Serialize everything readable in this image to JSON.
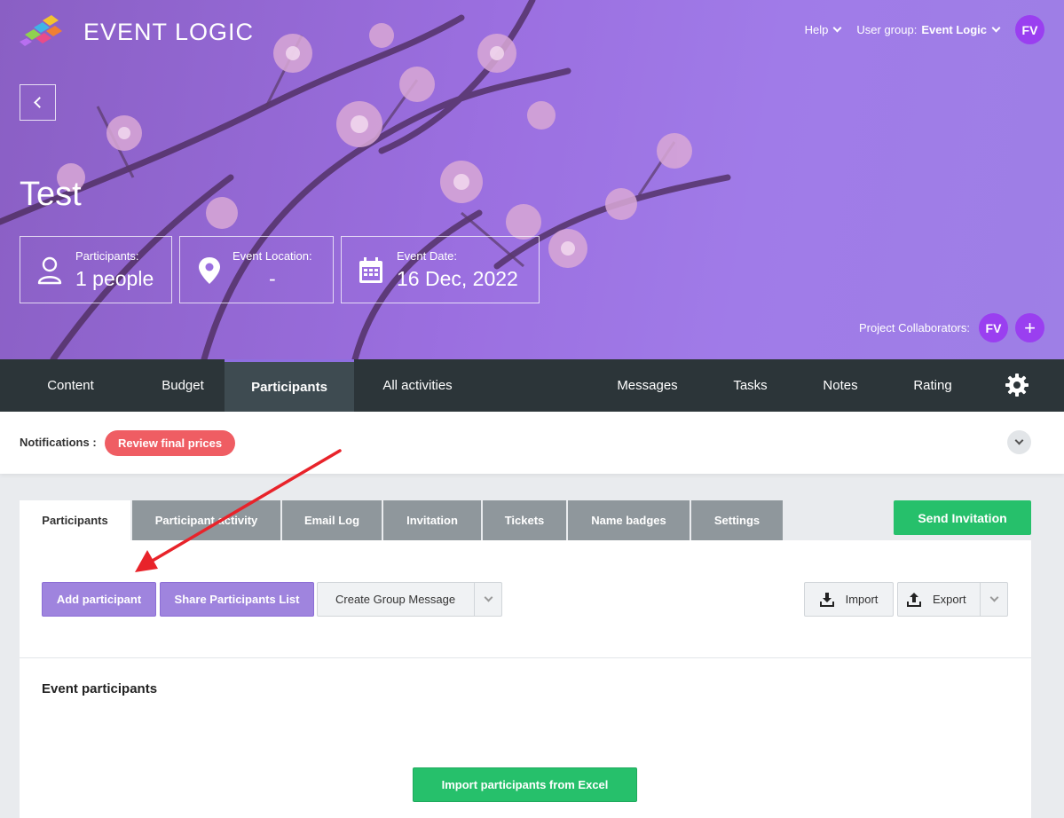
{
  "brand": {
    "name": "EVENT LOGIC"
  },
  "header": {
    "help_label": "Help",
    "user_group_label": "User group:",
    "user_group_value": "Event Logic",
    "user_initials": "FV"
  },
  "event": {
    "title": "Test",
    "info": [
      {
        "label": "Participants:",
        "value": "1 people",
        "icon": "person-icon"
      },
      {
        "label": "Event Location:",
        "value": "-",
        "icon": "location-pin-icon"
      },
      {
        "label": "Event Date:",
        "value": "16 Dec, 2022",
        "icon": "calendar-icon"
      }
    ],
    "collaborators_label": "Project Collaborators:",
    "collaborator_initials": "FV",
    "add_collaborator": "+"
  },
  "nav": {
    "items": [
      "Content",
      "Budget",
      "Participants",
      "All activities",
      "Messages",
      "Tasks",
      "Notes",
      "Rating"
    ],
    "active": "Participants"
  },
  "notifications": {
    "label": "Notifications :",
    "badge": "Review final prices"
  },
  "tabs": {
    "items": [
      "Participants",
      "Participant activity",
      "Email Log",
      "Invitation",
      "Tickets",
      "Name badges",
      "Settings"
    ],
    "active": "Participants"
  },
  "toolbar": {
    "send_invitation": "Send Invitation",
    "add_participant": "Add participant",
    "share_list": "Share Participants List",
    "group_message": "Create Group Message",
    "import": "Import",
    "export": "Export"
  },
  "participants_section": {
    "title": "Event participants",
    "import_excel": "Import participants from Excel"
  },
  "colors": {
    "hero": "#9b6fe0",
    "nav_bg": "#2c3539",
    "accent_green": "#26c06b",
    "accent_purple": "#9f84de",
    "badge_red": "#ef5d63",
    "annotation_arrow": "#e8232a"
  }
}
